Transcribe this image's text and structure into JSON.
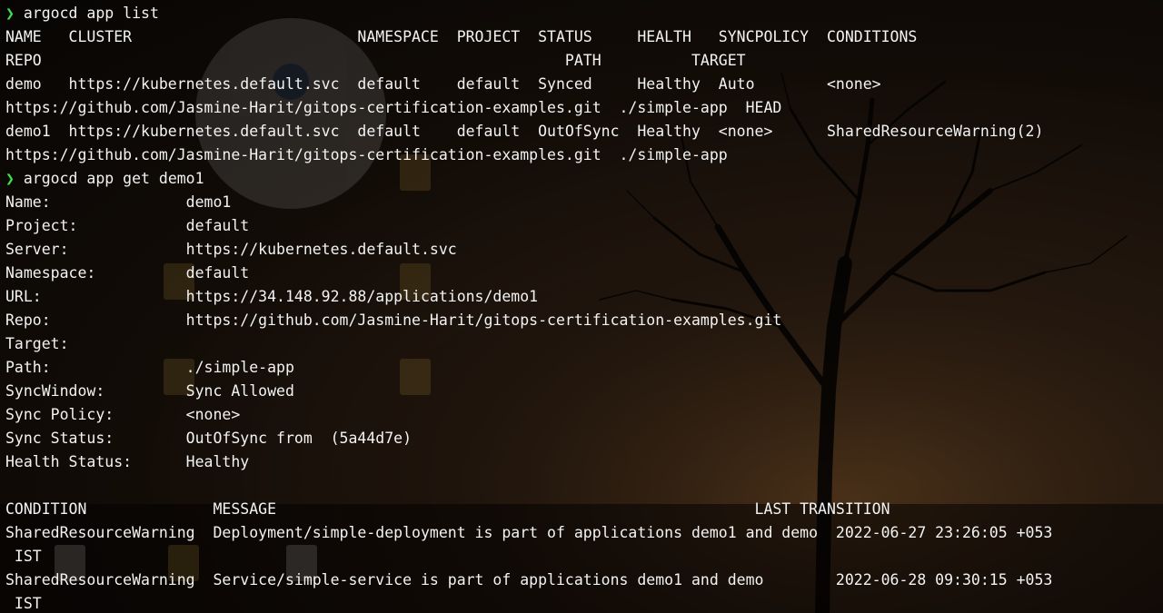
{
  "terminal": {
    "prompt_symbol": "❯",
    "lines": [
      {
        "type": "prompt",
        "command": "argocd app list"
      },
      {
        "type": "out",
        "text": "NAME   CLUSTER                         NAMESPACE  PROJECT  STATUS     HEALTH   SYNCPOLICY  CONDITIONS"
      },
      {
        "type": "out",
        "text": "REPO                                                          PATH          TARGET"
      },
      {
        "type": "out",
        "text": "demo   https://kubernetes.default.svc  default    default  Synced     Healthy  Auto        <none>"
      },
      {
        "type": "out",
        "text": "https://github.com/Jasmine-Harit/gitops-certification-examples.git  ./simple-app  HEAD"
      },
      {
        "type": "out",
        "text": "demo1  https://kubernetes.default.svc  default    default  OutOfSync  Healthy  <none>      SharedResourceWarning(2)"
      },
      {
        "type": "out",
        "text": "https://github.com/Jasmine-Harit/gitops-certification-examples.git  ./simple-app"
      },
      {
        "type": "prompt",
        "command": "argocd app get demo1"
      },
      {
        "type": "out",
        "text": "Name:               demo1"
      },
      {
        "type": "out",
        "text": "Project:            default"
      },
      {
        "type": "out",
        "text": "Server:             https://kubernetes.default.svc"
      },
      {
        "type": "out",
        "text": "Namespace:          default"
      },
      {
        "type": "out",
        "text": "URL:                https://34.148.92.88/applications/demo1"
      },
      {
        "type": "out",
        "text": "Repo:               https://github.com/Jasmine-Harit/gitops-certification-examples.git"
      },
      {
        "type": "out",
        "text": "Target:"
      },
      {
        "type": "out",
        "text": "Path:               ./simple-app"
      },
      {
        "type": "out",
        "text": "SyncWindow:         Sync Allowed"
      },
      {
        "type": "out",
        "text": "Sync Policy:        <none>"
      },
      {
        "type": "out",
        "text": "Sync Status:        OutOfSync from  (5a44d7e)"
      },
      {
        "type": "out",
        "text": "Health Status:      Healthy"
      },
      {
        "type": "blank",
        "text": ""
      },
      {
        "type": "out",
        "text": "CONDITION              MESSAGE                                                     LAST TRANSITION"
      },
      {
        "type": "out",
        "text": "SharedResourceWarning  Deployment/simple-deployment is part of applications demo1 and demo  2022-06-27 23:26:05 +053"
      },
      {
        "type": "out",
        "text": " IST"
      },
      {
        "type": "out",
        "text": "SharedResourceWarning  Service/simple-service is part of applications demo1 and demo        2022-06-28 09:30:15 +053"
      },
      {
        "type": "out",
        "text": " IST"
      }
    ]
  },
  "theme": {
    "prompt_color": "#3fe34a",
    "text_color": "#f3f3f3"
  }
}
